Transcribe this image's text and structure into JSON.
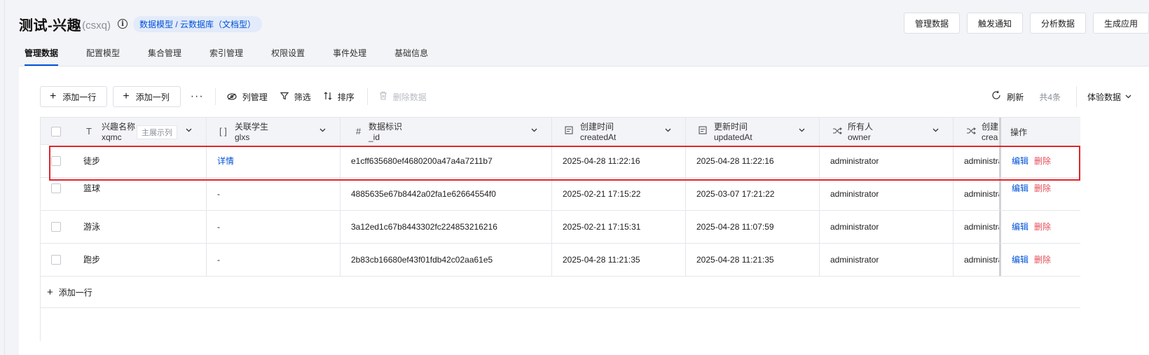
{
  "header": {
    "title": "测试-兴趣",
    "code": "(csxq)",
    "info_icon": "info-icon",
    "type_tag": "数据模型 / 云数据库（文档型）",
    "actions": [
      "管理数据",
      "触发通知",
      "分析数据",
      "生成应用"
    ]
  },
  "tabs": [
    "管理数据",
    "配置模型",
    "集合管理",
    "索引管理",
    "权限设置",
    "事件处理",
    "基础信息"
  ],
  "active_tab": "管理数据",
  "toolbar": {
    "add_row": "添加一行",
    "add_col": "添加一列",
    "more": "···",
    "columns": "列管理",
    "filter": "筛选",
    "sort": "排序",
    "delete": "删除数据",
    "refresh": "刷新",
    "count": "共4条",
    "demo_data": "体验数据"
  },
  "columns": [
    {
      "name": "兴趣名称",
      "field": "xqmc",
      "icon": "text-type-icon",
      "chip": "主展示列"
    },
    {
      "name": "关联学生",
      "field": "glxs",
      "icon": "relation-type-icon"
    },
    {
      "name": "数据标识",
      "field": "_id",
      "icon": "hash-icon"
    },
    {
      "name": "创建时间",
      "field": "createdAt",
      "icon": "datetime-icon"
    },
    {
      "name": "更新时间",
      "field": "updatedAt",
      "icon": "datetime-icon"
    },
    {
      "name": "所有人",
      "field": "owner",
      "icon": "user-relation-icon"
    },
    {
      "name": "创建",
      "field": "crea",
      "icon": "user-relation-icon"
    }
  ],
  "ops_header": "操作",
  "rows": [
    {
      "xqmc": "徒步",
      "glxs": "详情",
      "id": "e1cff635680ef4680200a47a4a7211b7",
      "createdAt": "2025-04-28 11:22:16",
      "updatedAt": "2025-04-28 11:22:16",
      "owner": "administrator",
      "creator": "administrat"
    },
    {
      "xqmc": "篮球",
      "glxs": "-",
      "id": "4885635e67b8442a02fa1e62664554f0",
      "createdAt": "2025-02-21 17:15:22",
      "updatedAt": "2025-03-07 17:21:22",
      "owner": "administrator",
      "creator": "administrat"
    },
    {
      "xqmc": "游泳",
      "glxs": "-",
      "id": "3a12ed1c67b8443302fc224853216216",
      "createdAt": "2025-02-21 17:15:31",
      "updatedAt": "2025-04-28 11:07:59",
      "owner": "administrator",
      "creator": "administrat"
    },
    {
      "xqmc": "跑步",
      "glxs": "-",
      "id": "2b83cb16680ef43f01fdb42c02aa61e5",
      "createdAt": "2025-04-28 11:21:35",
      "updatedAt": "2025-04-28 11:21:35",
      "owner": "administrator",
      "creator": "administrat"
    }
  ],
  "row_actions": {
    "edit": "编辑",
    "delete": "删除"
  },
  "add_row_footer": "添加一行",
  "colors": {
    "accent": "#0052d9",
    "danger": "#e34d59",
    "highlight": "#e0242b"
  }
}
